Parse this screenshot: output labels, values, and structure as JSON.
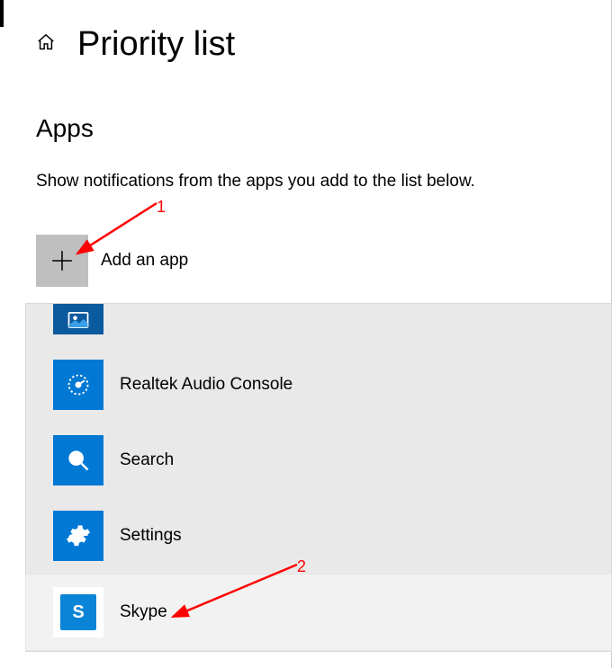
{
  "header": {
    "title": "Priority list"
  },
  "section": {
    "title": "Apps",
    "description": "Show notifications from the apps you add to the list below.",
    "addLabel": "Add an app"
  },
  "list": {
    "items": [
      {
        "label": "",
        "icon": "photos-icon"
      },
      {
        "label": "Realtek Audio Console",
        "icon": "dial-icon"
      },
      {
        "label": "Search",
        "icon": "search-icon"
      },
      {
        "label": "Settings",
        "icon": "gear-icon"
      },
      {
        "label": "Skype",
        "icon": "skype-icon"
      }
    ]
  },
  "annotations": {
    "one": "1",
    "two": "2"
  },
  "colors": {
    "accent": "#0078d4",
    "arrow": "#ff0000"
  }
}
